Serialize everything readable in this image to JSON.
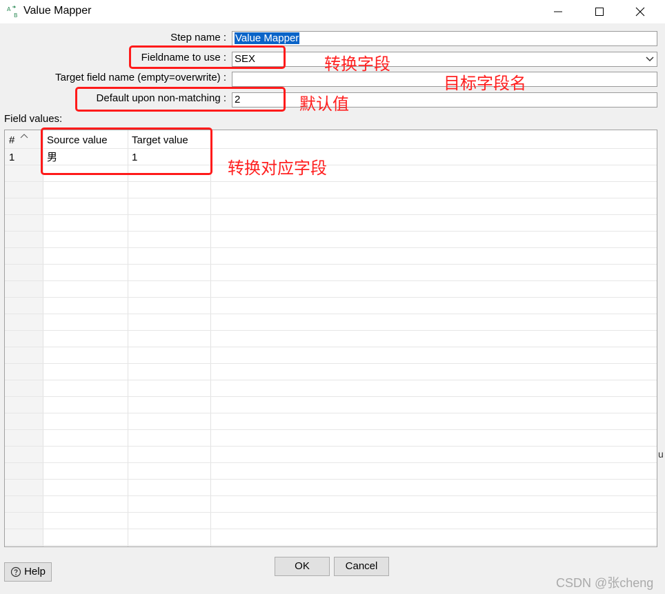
{
  "window": {
    "title": "Value Mapper",
    "controls": {
      "minimize": "minimize-icon",
      "maximize": "maximize-icon",
      "close": "close-icon"
    }
  },
  "form": {
    "step_name": {
      "label": "Step name :",
      "value": "Value Mapper"
    },
    "fieldname_to_use": {
      "label": "Fieldname to use :",
      "value": "SEX"
    },
    "target_field_name": {
      "label": "Target field name (empty=overwrite) :",
      "value": ""
    },
    "default_non_matching": {
      "label": "Default upon non-matching :",
      "value": "2"
    }
  },
  "field_values": {
    "label": "Field values:",
    "columns": [
      "#",
      "Source value",
      "Target value"
    ],
    "rows": [
      {
        "num": "1",
        "source": "男",
        "target": "1"
      }
    ]
  },
  "buttons": {
    "help": "Help",
    "ok": "OK",
    "cancel": "Cancel"
  },
  "annotations": {
    "fieldname": "转换字段",
    "target_field": "目标字段名",
    "default_value": "默认值",
    "mapping": "转换对应字段"
  },
  "watermark": "CSDN @张cheng",
  "edge_glyph": "u",
  "colors": {
    "annotation": "#ff1a1a",
    "selection": "#0a64c8"
  }
}
